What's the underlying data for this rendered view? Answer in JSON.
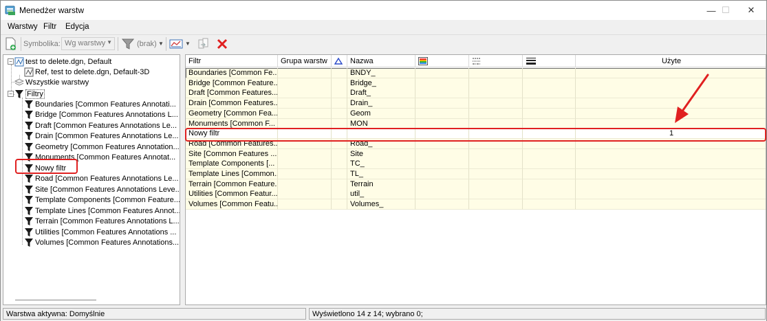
{
  "window": {
    "title": "Menedżer warstw",
    "controls": {
      "minimize": "—",
      "maximize": "☐",
      "close": "✕"
    }
  },
  "menu": [
    {
      "label": "Warstwy",
      "accel": "W"
    },
    {
      "label": "Filtr",
      "accel": "F"
    },
    {
      "label": "Edycja",
      "accel": "E"
    }
  ],
  "toolbar": {
    "symbology_label": "Symbolika:",
    "symbology_value": "Wg warstwy",
    "filter_value": "(brak)",
    "icons": [
      "new-layer-icon",
      "funnel-icon",
      "display-style-icon",
      "copy-layer-icon",
      "delete-icon"
    ]
  },
  "tree": {
    "root_file": "test to delete.dgn, Default",
    "ref_file": "Ref, test to delete.dgn, Default-3D",
    "all_layers": "Wszystkie warstwy",
    "filters_label": "Filtry",
    "filters": [
      "Boundaries [Common Features Annotati...",
      "Bridge [Common Features Annotations L...",
      "Draft [Common Features Annotations Le...",
      "Drain [Common Features Annotations Le...",
      "Geometry [Common Features Annotation...",
      "Monuments [Common Features Annotat...",
      "Nowy filtr",
      "Road [Common Features Annotations Le...",
      "Site [Common Features Annotations Leve...",
      "Template Components [Common Feature...",
      "Template Lines [Common Features Annot...",
      "Terrain [Common Features Annotations L...",
      "Utilities [Common Features Annotations ...",
      "Volumes [Common Features Annotations..."
    ]
  },
  "grid": {
    "columns": {
      "filter": "Filtr",
      "group": "Grupa warstw",
      "name": "Nazwa",
      "used": "Użyte"
    },
    "rows": [
      {
        "filter": "Boundaries [Common Fe...",
        "name": "BNDY_",
        "used": ""
      },
      {
        "filter": "Bridge [Common Feature...",
        "name": "Bridge_",
        "used": ""
      },
      {
        "filter": "Draft [Common Features...",
        "name": "Draft_",
        "used": ""
      },
      {
        "filter": "Drain [Common Features...",
        "name": "Drain_",
        "used": ""
      },
      {
        "filter": "Geometry [Common Fea...",
        "name": "Geom",
        "used": ""
      },
      {
        "filter": "Monuments [Common F...",
        "name": "MON",
        "used": ""
      },
      {
        "filter": "Nowy filtr",
        "name": "",
        "used": "1"
      },
      {
        "filter": "Road [Common Features...",
        "name": "Road_",
        "used": ""
      },
      {
        "filter": "Site [Common Features ...",
        "name": "Site",
        "used": ""
      },
      {
        "filter": "Template Components [...",
        "name": "TC_",
        "used": ""
      },
      {
        "filter": "Template Lines [Common...",
        "name": "TL_",
        "used": ""
      },
      {
        "filter": "Terrain [Common Feature...",
        "name": "Terrain",
        "used": ""
      },
      {
        "filter": "Utilities [Common Featur...",
        "name": "util_",
        "used": ""
      },
      {
        "filter": "Volumes [Common Featu...",
        "name": "Volumes_",
        "used": ""
      }
    ]
  },
  "status": {
    "active_layer": "Warstwa aktywna: Domyślnie",
    "displayed": "Wyświetlono 14 z 14; wybrano 0;"
  },
  "colors": {
    "highlight": "#e02020",
    "row_bg": "#fffde6"
  }
}
